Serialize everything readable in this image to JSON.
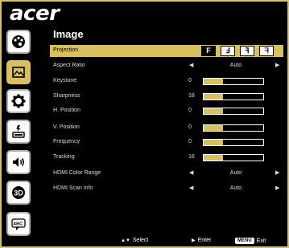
{
  "brand": {
    "logo": "acer"
  },
  "menu": {
    "title": "Image"
  },
  "sidebar": {
    "items": [
      {
        "name": "color-palette-icon",
        "active": false
      },
      {
        "name": "image-icon",
        "active": true
      },
      {
        "name": "settings-gear-icon",
        "active": false
      },
      {
        "name": "power-icon",
        "active": false
      },
      {
        "name": "audio-speaker-icon",
        "active": false
      },
      {
        "name": "3d-icon",
        "active": false
      },
      {
        "name": "language-icon",
        "active": false
      }
    ]
  },
  "rows": {
    "projection": {
      "label": "Projection",
      "icons": [
        "F",
        "Ⅎ",
        "ꟻ",
        "ᖷ"
      ]
    },
    "aspect_ratio": {
      "label": "Aspect Ratio",
      "value": "Auto"
    },
    "keystone": {
      "label": "Keystone",
      "value": "0",
      "level": 0.33
    },
    "sharpness": {
      "label": "Sharpness",
      "value": "18",
      "level": 0.33
    },
    "h_position": {
      "label": "H. Position",
      "value": "0",
      "level": 0.33
    },
    "v_position": {
      "label": "V. Position",
      "value": "0",
      "level": 0.33
    },
    "frequency": {
      "label": "Frequency",
      "value": "0",
      "level": 0.33
    },
    "tracking": {
      "label": "Tracking",
      "value": "16",
      "level": 0.33
    },
    "hdmi_color_range": {
      "label": "HDMI Color Range",
      "value": "Auto"
    },
    "hdmi_scan_info": {
      "label": "HDMI Scan Info",
      "value": "Auto"
    }
  },
  "footer": {
    "select_label": "Select",
    "enter_label": "Enter",
    "menu_key": "MENU",
    "exit_label": "Exit"
  },
  "colors": {
    "accent": "#d8c060",
    "frame": "#d8c060"
  }
}
